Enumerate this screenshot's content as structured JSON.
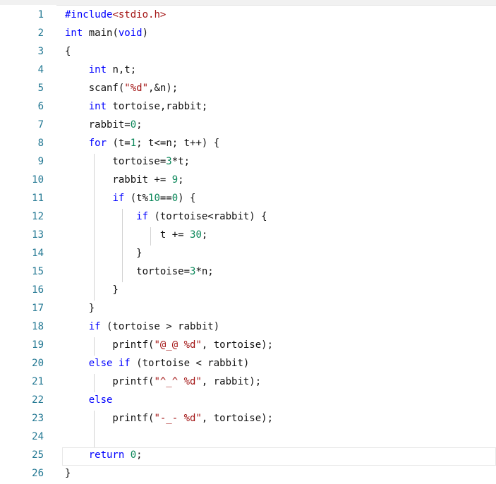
{
  "editor": {
    "lines": [
      {
        "n": "1",
        "parts": [
          {
            "t": "#include",
            "c": "kw"
          },
          {
            "t": "<stdio.h>",
            "c": "str"
          }
        ]
      },
      {
        "n": "2",
        "parts": [
          {
            "t": "int",
            "c": "kw"
          },
          {
            "t": " main(",
            "c": ""
          },
          {
            "t": "void",
            "c": "kw"
          },
          {
            "t": ")",
            "c": ""
          }
        ]
      },
      {
        "n": "3",
        "parts": [
          {
            "t": "{",
            "c": ""
          }
        ]
      },
      {
        "n": "4",
        "parts": [
          {
            "t": "    ",
            "c": ""
          },
          {
            "t": "int",
            "c": "kw"
          },
          {
            "t": " n,t;",
            "c": ""
          }
        ]
      },
      {
        "n": "5",
        "parts": [
          {
            "t": "    scanf(",
            "c": ""
          },
          {
            "t": "\"%d\"",
            "c": "str"
          },
          {
            "t": ",&n);",
            "c": ""
          }
        ]
      },
      {
        "n": "6",
        "parts": [
          {
            "t": "    ",
            "c": ""
          },
          {
            "t": "int",
            "c": "kw"
          },
          {
            "t": " tortoise,rabbit;",
            "c": ""
          }
        ]
      },
      {
        "n": "7",
        "parts": [
          {
            "t": "    rabbit=",
            "c": ""
          },
          {
            "t": "0",
            "c": "num"
          },
          {
            "t": ";",
            "c": ""
          }
        ]
      },
      {
        "n": "8",
        "parts": [
          {
            "t": "    ",
            "c": ""
          },
          {
            "t": "for",
            "c": "kw"
          },
          {
            "t": " (t=",
            "c": ""
          },
          {
            "t": "1",
            "c": "num"
          },
          {
            "t": "; t<=n; t++) {",
            "c": ""
          }
        ]
      },
      {
        "n": "9",
        "parts": [
          {
            "t": "        tortoise=",
            "c": ""
          },
          {
            "t": "3",
            "c": "num"
          },
          {
            "t": "*t;",
            "c": ""
          }
        ]
      },
      {
        "n": "10",
        "parts": [
          {
            "t": "        rabbit += ",
            "c": ""
          },
          {
            "t": "9",
            "c": "num"
          },
          {
            "t": ";",
            "c": ""
          }
        ]
      },
      {
        "n": "11",
        "parts": [
          {
            "t": "        ",
            "c": ""
          },
          {
            "t": "if",
            "c": "kw"
          },
          {
            "t": " (t%",
            "c": ""
          },
          {
            "t": "10",
            "c": "num"
          },
          {
            "t": "==",
            "c": ""
          },
          {
            "t": "0",
            "c": "num"
          },
          {
            "t": ") {",
            "c": ""
          }
        ]
      },
      {
        "n": "12",
        "parts": [
          {
            "t": "            ",
            "c": ""
          },
          {
            "t": "if",
            "c": "kw"
          },
          {
            "t": " (tortoise<rabbit) {",
            "c": ""
          }
        ]
      },
      {
        "n": "13",
        "parts": [
          {
            "t": "                t += ",
            "c": ""
          },
          {
            "t": "30",
            "c": "num"
          },
          {
            "t": ";",
            "c": ""
          }
        ]
      },
      {
        "n": "14",
        "parts": [
          {
            "t": "            }",
            "c": ""
          }
        ]
      },
      {
        "n": "15",
        "parts": [
          {
            "t": "            tortoise=",
            "c": ""
          },
          {
            "t": "3",
            "c": "num"
          },
          {
            "t": "*n;",
            "c": ""
          }
        ]
      },
      {
        "n": "16",
        "parts": [
          {
            "t": "        }",
            "c": ""
          }
        ]
      },
      {
        "n": "17",
        "parts": [
          {
            "t": "    }",
            "c": ""
          }
        ]
      },
      {
        "n": "18",
        "parts": [
          {
            "t": "    ",
            "c": ""
          },
          {
            "t": "if",
            "c": "kw"
          },
          {
            "t": " (tortoise > rabbit)",
            "c": ""
          }
        ]
      },
      {
        "n": "19",
        "parts": [
          {
            "t": "        printf(",
            "c": ""
          },
          {
            "t": "\"@_@ %d\"",
            "c": "str"
          },
          {
            "t": ", tortoise);",
            "c": ""
          }
        ]
      },
      {
        "n": "20",
        "parts": [
          {
            "t": "    ",
            "c": ""
          },
          {
            "t": "else",
            "c": "kw"
          },
          {
            "t": " ",
            "c": ""
          },
          {
            "t": "if",
            "c": "kw"
          },
          {
            "t": " (tortoise < rabbit)",
            "c": ""
          }
        ]
      },
      {
        "n": "21",
        "parts": [
          {
            "t": "        printf(",
            "c": ""
          },
          {
            "t": "\"^_^ %d\"",
            "c": "str"
          },
          {
            "t": ", rabbit);",
            "c": ""
          }
        ]
      },
      {
        "n": "22",
        "parts": [
          {
            "t": "    ",
            "c": ""
          },
          {
            "t": "else",
            "c": "kw"
          }
        ]
      },
      {
        "n": "23",
        "parts": [
          {
            "t": "        printf(",
            "c": ""
          },
          {
            "t": "\"-_- %d\"",
            "c": "str"
          },
          {
            "t": ", tortoise);",
            "c": ""
          }
        ]
      },
      {
        "n": "24",
        "parts": [
          {
            "t": "",
            "c": ""
          }
        ]
      },
      {
        "n": "25",
        "parts": [
          {
            "t": "    ",
            "c": ""
          },
          {
            "t": "return",
            "c": "kw"
          },
          {
            "t": " ",
            "c": ""
          },
          {
            "t": "0",
            "c": "num"
          },
          {
            "t": ";",
            "c": ""
          }
        ]
      },
      {
        "n": "26",
        "parts": [
          {
            "t": "}",
            "c": ""
          }
        ]
      }
    ]
  },
  "colors": {
    "keyword": "#0000ff",
    "string": "#a31515",
    "number": "#098658",
    "line_number": "#237893",
    "text": "#111111",
    "indent_guide": "#d3d3d3"
  }
}
